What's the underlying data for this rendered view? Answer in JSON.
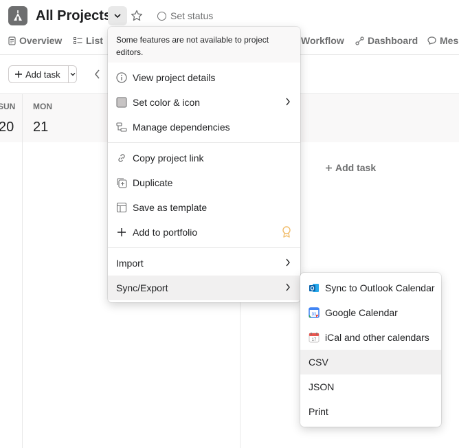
{
  "header": {
    "title": "All Projects",
    "set_status": "Set status"
  },
  "tabs": [
    {
      "label": "Overview",
      "icon": "document-icon"
    },
    {
      "label": "List",
      "icon": "list-icon"
    },
    {
      "label": "Workflow",
      "icon": "workflow-icon"
    },
    {
      "label": "Dashboard",
      "icon": "dashboard-icon"
    },
    {
      "label": "Mess",
      "icon": "message-icon"
    }
  ],
  "toolbar": {
    "add_task": "Add task"
  },
  "calendar": {
    "days": [
      {
        "name": "SUN",
        "number": "20"
      },
      {
        "name": "MON",
        "number": "21"
      }
    ],
    "add_task": "Add task"
  },
  "menu": {
    "note": "Some features are not available to project editors.",
    "items": [
      {
        "label": "View project details",
        "icon": "info-icon"
      },
      {
        "label": "Set color & icon",
        "icon": "color-swatch-icon"
      },
      {
        "label": "Manage dependencies",
        "icon": "dependencies-icon"
      },
      {
        "label": "Copy project link",
        "icon": "link-icon"
      },
      {
        "label": "Duplicate",
        "icon": "duplicate-icon"
      },
      {
        "label": "Save as template",
        "icon": "template-icon"
      },
      {
        "label": "Add to portfolio",
        "icon": "plus-icon"
      },
      {
        "label": "Import",
        "icon": ""
      },
      {
        "label": "Sync/Export",
        "icon": ""
      }
    ]
  },
  "submenu": {
    "items": [
      {
        "label": "Sync to Outlook Calendar",
        "icon": "outlook-icon"
      },
      {
        "label": "Google Calendar",
        "icon": "google-calendar-icon"
      },
      {
        "label": "iCal and other calendars",
        "icon": "ical-icon"
      },
      {
        "label": "CSV"
      },
      {
        "label": "JSON"
      },
      {
        "label": "Print"
      }
    ]
  },
  "colors": {
    "text": "#1e1f21",
    "muted": "#6d6e6f",
    "hover": "#f1f0f0",
    "badge": "#f1bd6c"
  }
}
